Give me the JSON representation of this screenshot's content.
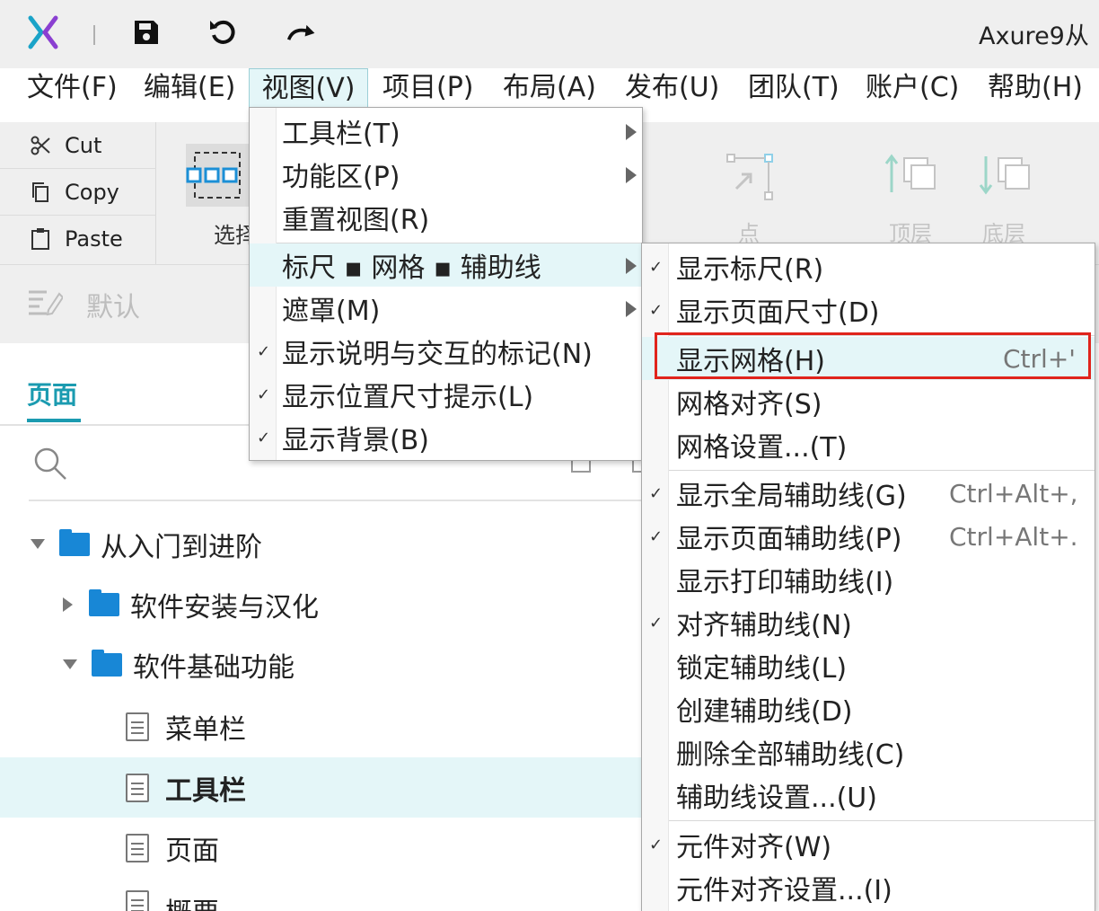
{
  "titlebar": {
    "app_title": "Axure9从",
    "icons": [
      "axure-logo-icon",
      "save-icon",
      "undo-icon",
      "redo-icon"
    ]
  },
  "menubar": {
    "items": [
      "文件(F)",
      "编辑(E)",
      "视图(V)",
      "项目(P)",
      "布局(A)",
      "发布(U)",
      "团队(T)",
      "账户(C)",
      "帮助(H)"
    ],
    "open_item": "视图(V)"
  },
  "toolbar": {
    "cut": "Cut",
    "copy": "Copy",
    "paste": "Paste",
    "select_label": "选择",
    "point_label": "点",
    "top_layer_label": "顶层",
    "bottom_layer_label": "底层"
  },
  "stylebar": {
    "style_label": "默认"
  },
  "pages_panel": {
    "tab_label": "页面",
    "tree": [
      {
        "label": "从入门到进阶",
        "type": "folder",
        "expanded": true,
        "level": 0
      },
      {
        "label": "软件安装与汉化",
        "type": "folder",
        "expanded": false,
        "level": 1
      },
      {
        "label": "软件基础功能",
        "type": "folder",
        "expanded": true,
        "level": 1
      },
      {
        "label": "菜单栏",
        "type": "page",
        "level": 2
      },
      {
        "label": "工具栏",
        "type": "page",
        "level": 2,
        "selected": true
      },
      {
        "label": "页面",
        "type": "page",
        "level": 2
      },
      {
        "label": "概要",
        "type": "page",
        "level": 2
      }
    ]
  },
  "view_menu": {
    "items": [
      {
        "label": "工具栏(T)",
        "submenu": true,
        "checked": false
      },
      {
        "label": "功能区(P)",
        "submenu": true,
        "checked": false
      },
      {
        "label": "重置视图(R)",
        "submenu": false,
        "checked": false
      },
      {
        "label": "标尺 ▪ 网格 ▪ 辅助线",
        "submenu": true,
        "checked": false,
        "highlighted": true
      },
      {
        "label": "遮罩(M)",
        "submenu": true,
        "checked": false
      },
      {
        "label": "显示说明与交互的标记(N)",
        "submenu": false,
        "checked": true
      },
      {
        "label": "显示位置尺寸提示(L)",
        "submenu": false,
        "checked": true
      },
      {
        "label": "显示背景(B)",
        "submenu": false,
        "checked": true
      }
    ]
  },
  "ruler_grid_menu": {
    "items": [
      {
        "label": "显示标尺(R)",
        "checked": true,
        "shortcut": ""
      },
      {
        "label": "显示页面尺寸(D)",
        "checked": true,
        "shortcut": ""
      },
      {
        "label": "显示网格(H)",
        "checked": false,
        "shortcut": "Ctrl+'",
        "highlighted": true
      },
      {
        "label": "网格对齐(S)",
        "checked": false,
        "shortcut": ""
      },
      {
        "label": "网格设置...(T)",
        "checked": false,
        "shortcut": ""
      },
      {
        "label": "显示全局辅助线(G)",
        "checked": true,
        "shortcut": "Ctrl+Alt+,"
      },
      {
        "label": "显示页面辅助线(P)",
        "checked": true,
        "shortcut": "Ctrl+Alt+."
      },
      {
        "label": "显示打印辅助线(I)",
        "checked": false,
        "shortcut": ""
      },
      {
        "label": "对齐辅助线(N)",
        "checked": true,
        "shortcut": ""
      },
      {
        "label": "锁定辅助线(L)",
        "checked": false,
        "shortcut": ""
      },
      {
        "label": "创建辅助线(D)",
        "checked": false,
        "shortcut": ""
      },
      {
        "label": "删除全部辅助线(C)",
        "checked": false,
        "shortcut": ""
      },
      {
        "label": "辅助线设置...(U)",
        "checked": false,
        "shortcut": ""
      },
      {
        "label": "元件对齐(W)",
        "checked": true,
        "shortcut": ""
      },
      {
        "label": "元件对齐设置...(I)",
        "checked": false,
        "shortcut": ""
      }
    ]
  },
  "check_mark": "✓",
  "colors": {
    "accent": "#1b9bb0",
    "folder": "#1887d6",
    "highlight_bg": "#e4f6f8",
    "annotation_red": "#e0241c"
  }
}
